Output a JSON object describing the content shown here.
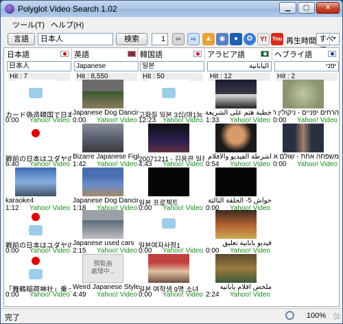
{
  "window": {
    "title": "Polyglot Video Search 1.02"
  },
  "menu": {
    "tools": "ツール(T)",
    "help": "ヘルプ(H)"
  },
  "toolbar": {
    "language_button": "言語",
    "query": "日本人",
    "search_button": "検索",
    "page": "1",
    "playtime_label": "再生時間",
    "playtime_value": "すべて"
  },
  "columns": [
    {
      "header": "日本語",
      "flag_color": "#ffffff",
      "flag_mark": "#cc0000",
      "query": "日本人",
      "hit": "Hit : 7",
      "rtl": false,
      "items": [
        {
          "caption": "カード偽造韓国で日本人",
          "duration": "0:00",
          "source": "Yahoo! Video",
          "thumb": "ph"
        },
        {
          "caption": "戦前の日本はユダヤの理",
          "duration": "6:40",
          "source": "Yahoo! Video",
          "thumb": "flag"
        },
        {
          "caption": "karaoke4",
          "duration": "1:12",
          "source": "Yahoo! Video",
          "thumb": "tv"
        },
        {
          "caption": "戦前の日本はユダヤの理",
          "duration": "0:00",
          "source": "Yahoo! Video",
          "thumb": "flagph"
        },
        {
          "caption": "「舞鶴稲荷神社」乗っ取",
          "duration": "0:00",
          "source": "Yahoo! Video",
          "thumb": "flagph"
        }
      ]
    },
    {
      "header": "英語",
      "flag_color": "#b22234",
      "flag_mark": "#3c3b6e",
      "query": "Japanese",
      "hit": "Hit : 8,550",
      "rtl": false,
      "items": [
        {
          "caption": "Japanese Dog Dancing",
          "duration": "0:00",
          "source": "Yahoo! Video",
          "thumb": "dog"
        },
        {
          "caption": "Bizarre Japanese Fight",
          "duration": "1:42",
          "source": "Yahoo! Video",
          "thumb": "fight"
        },
        {
          "caption": "Japanese Dog Dancing",
          "duration": "1:18",
          "source": "Yahoo! Video",
          "thumb": "dog2"
        },
        {
          "caption": "Japanese used cars",
          "duration": "2:15",
          "source": "Yahoo! Video",
          "thumb": "cars"
        },
        {
          "caption": "Weird Japanese Style E",
          "duration": "4:49",
          "source": "Yahoo! Video",
          "thumb": "processing",
          "thumb_text": "預覧画\n處理中..."
        }
      ]
    },
    {
      "header": "韓国語",
      "flag_color": "#ffffff",
      "flag_mark": "#c60c30",
      "query": "일본",
      "hit": "Hit : 50",
      "rtl": false,
      "items": [
        {
          "caption": "고화질 일본 3십(며1능",
          "duration": "12:23",
          "source": "Yahoo! Video",
          "thumb": "ph"
        },
        {
          "caption": "20071211 - 김용관 일본",
          "duration": "4:43",
          "source": "Yahoo! Video",
          "thumb": "dark"
        },
        {
          "caption": "일본 프로젝트",
          "duration": "0:00",
          "source": "Yahoo! Video",
          "thumb": "black"
        },
        {
          "caption": "일본여자사정1",
          "duration": "0:00",
          "source": "Yahoo! Video",
          "thumb": "ph"
        },
        {
          "caption": "일본 여학생 9명 소녀",
          "duration": "0:00",
          "source": "Yahoo! Video",
          "thumb": "dance"
        }
      ]
    },
    {
      "header": "アラビア語",
      "flag_color": "#006c35",
      "flag_mark": "#ffffff",
      "query": "اليابانية",
      "hit": "Hit : 12",
      "rtl": true,
      "items": [
        {
          "caption": "خطبة هتم على الشريعة اليابانية",
          "duration": "1:33",
          "source": "Yahoo! Video",
          "thumb": "night"
        },
        {
          "caption": "أشرطة الفيديو والأفلام مشتركة بين الحسين",
          "duration": "0:54",
          "source": "Yahoo! Video",
          "thumb": "woman"
        },
        {
          "caption": "حواش 5- الحلقة الثالثة يابانية وأفلام",
          "duration": "0:00",
          "source": "Yahoo! Video",
          "thumb": "black"
        },
        {
          "caption": "فيديو يابانية تعليق",
          "duration": "0:00",
          "source": "Yahoo! Video",
          "thumb": "room"
        },
        {
          "caption": "ملخص أفلام يابانية",
          "duration": "2:24",
          "source": "Yahoo! Video",
          "thumb": "room2"
        }
      ]
    },
    {
      "header": "ヘブライ語",
      "flag_color": "#ffffff",
      "flag_mark": "#0038b8",
      "query": "יפני",
      "hit": "Hit : 2",
      "rtl": true,
      "items": [
        {
          "caption": "הרחים יפניים - ניקולין הרחים",
          "duration": "0:00",
          "source": "Yahoo! Video",
          "thumb": "moss"
        },
        {
          "caption": "משפחה אחת - שולם אחד",
          "duration": "0:00",
          "source": "Yahoo! Video",
          "thumb": "man"
        }
      ]
    }
  ],
  "status": {
    "text": "完了",
    "zoom": "100%"
  }
}
